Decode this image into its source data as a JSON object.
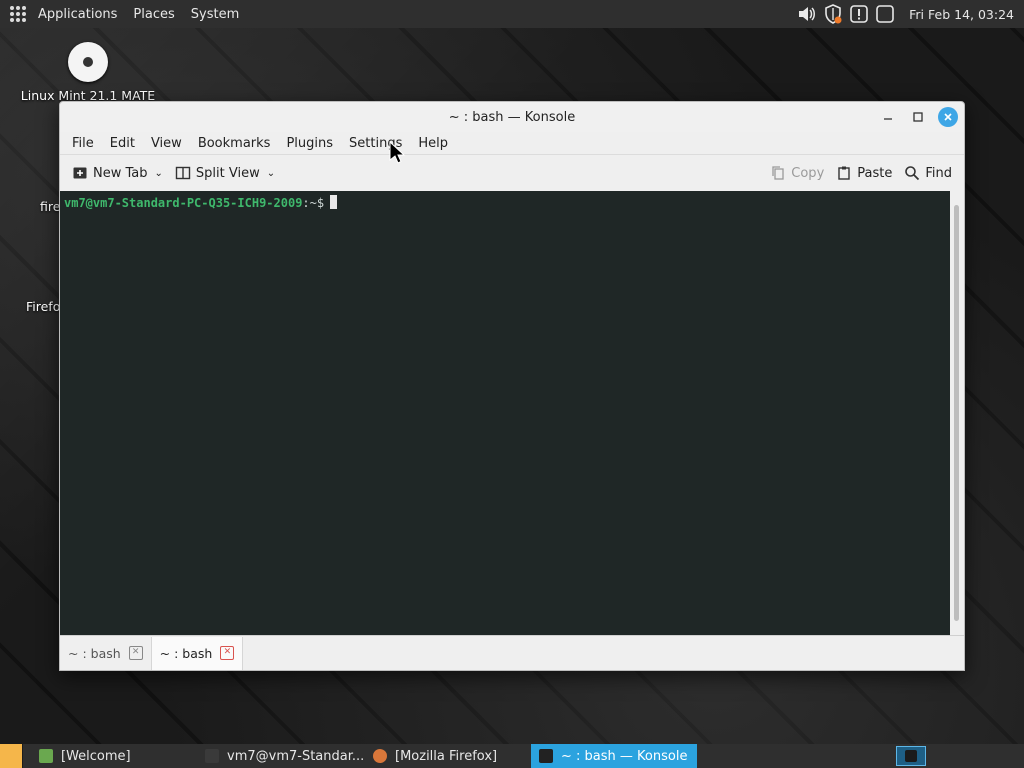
{
  "top_panel": {
    "menus": [
      "Applications",
      "Places",
      "System"
    ],
    "clock": "Fri Feb 14, 03:24",
    "tray_icons": [
      "volume-icon",
      "shield-update-icon",
      "notification-icon",
      "window-icon"
    ]
  },
  "desktop": {
    "icons": [
      {
        "label": "Linux Mint 21.1 MATE",
        "icon": "disc-icon"
      },
      {
        "label": "fire",
        "icon": "firefox-icon"
      },
      {
        "label": "Firefo",
        "icon": "firefox-icon"
      }
    ]
  },
  "window": {
    "title": "~ : bash — Konsole",
    "menus": [
      "File",
      "Edit",
      "View",
      "Bookmarks",
      "Plugins",
      "Settings",
      "Help"
    ],
    "toolbar": {
      "new_tab": "New Tab",
      "split_view": "Split View",
      "copy": "Copy",
      "paste": "Paste",
      "find": "Find"
    },
    "terminal": {
      "user_host": "vm7@vm7-Standard-PC-Q35-ICH9-2009",
      "path": ":~$"
    },
    "tabs": [
      {
        "label": "~ : bash",
        "active": false
      },
      {
        "label": "~ : bash",
        "active": true
      }
    ]
  },
  "taskbar": {
    "tasks": [
      {
        "label": "[Welcome]",
        "color": "#6aa84f",
        "active": false
      },
      {
        "label": "vm7@vm7-Standar...",
        "color": "#3a3a3a",
        "active": false
      },
      {
        "label": "[Mozilla Firefox]",
        "color": "#d9773a",
        "active": false
      },
      {
        "label": "~ : bash — Konsole",
        "color": "#222222",
        "active": true
      }
    ]
  },
  "colors": {
    "accent": "#2ba3df",
    "terminal_bg": "#1f2726",
    "prompt_green": "#3fb86c"
  }
}
